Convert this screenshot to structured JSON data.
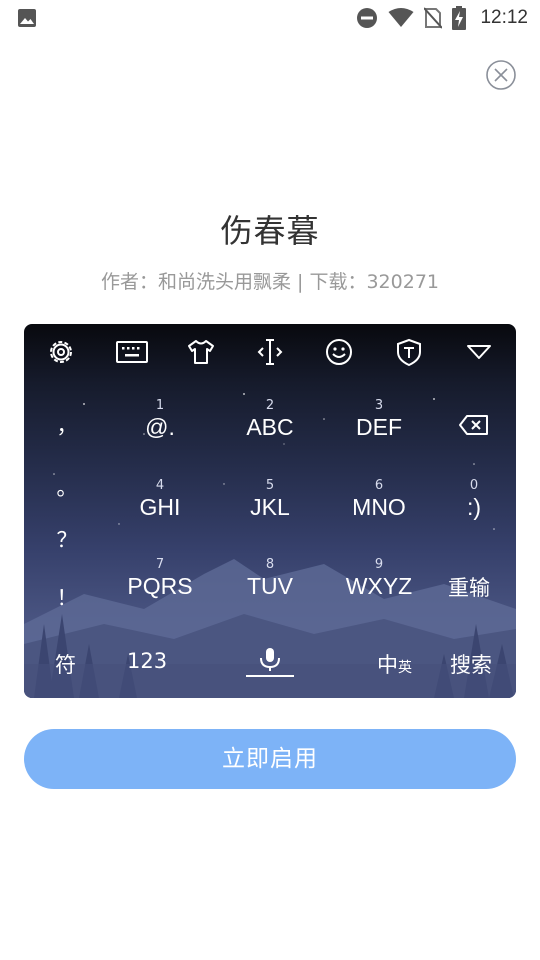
{
  "status_bar": {
    "time": "12:12",
    "icons": [
      "image-icon",
      "do-not-disturb-icon",
      "wifi-icon",
      "no-sim-icon",
      "battery-charging-icon"
    ]
  },
  "close_icon": "close-circle-icon",
  "theme": {
    "title": "伤春暮",
    "meta": "作者：和尚洗头用飘柔 | 下载：320271"
  },
  "keyboard": {
    "toolbar": [
      "settings-icon",
      "keyboard-icon",
      "tshirt-icon",
      "cursor-icon",
      "emoji-icon",
      "shield-icon",
      "collapse-icon"
    ],
    "side_symbols": [
      "，",
      "。",
      "？",
      "！"
    ],
    "keys": [
      {
        "num": "1",
        "label": "@."
      },
      {
        "num": "2",
        "label": "ABC"
      },
      {
        "num": "3",
        "label": "DEF"
      },
      {
        "num": "4",
        "label": "GHI"
      },
      {
        "num": "5",
        "label": "JKL"
      },
      {
        "num": "6",
        "label": "MNO"
      },
      {
        "num": "0",
        "label": ":)"
      },
      {
        "num": "7",
        "label": "PQRS"
      },
      {
        "num": "8",
        "label": "TUV"
      },
      {
        "num": "9",
        "label": "WXYZ"
      }
    ],
    "backspace_icon": "backspace-icon",
    "retype": "重输",
    "bottom": {
      "symbols": "符",
      "numbers": "123",
      "mic_icon": "microphone-icon",
      "lang_main": "中",
      "lang_sub": "英",
      "search": "搜索"
    }
  },
  "enable_button": "立即启用",
  "colors": {
    "accent": "#7db3f7",
    "title": "#333333",
    "meta": "#999999"
  }
}
